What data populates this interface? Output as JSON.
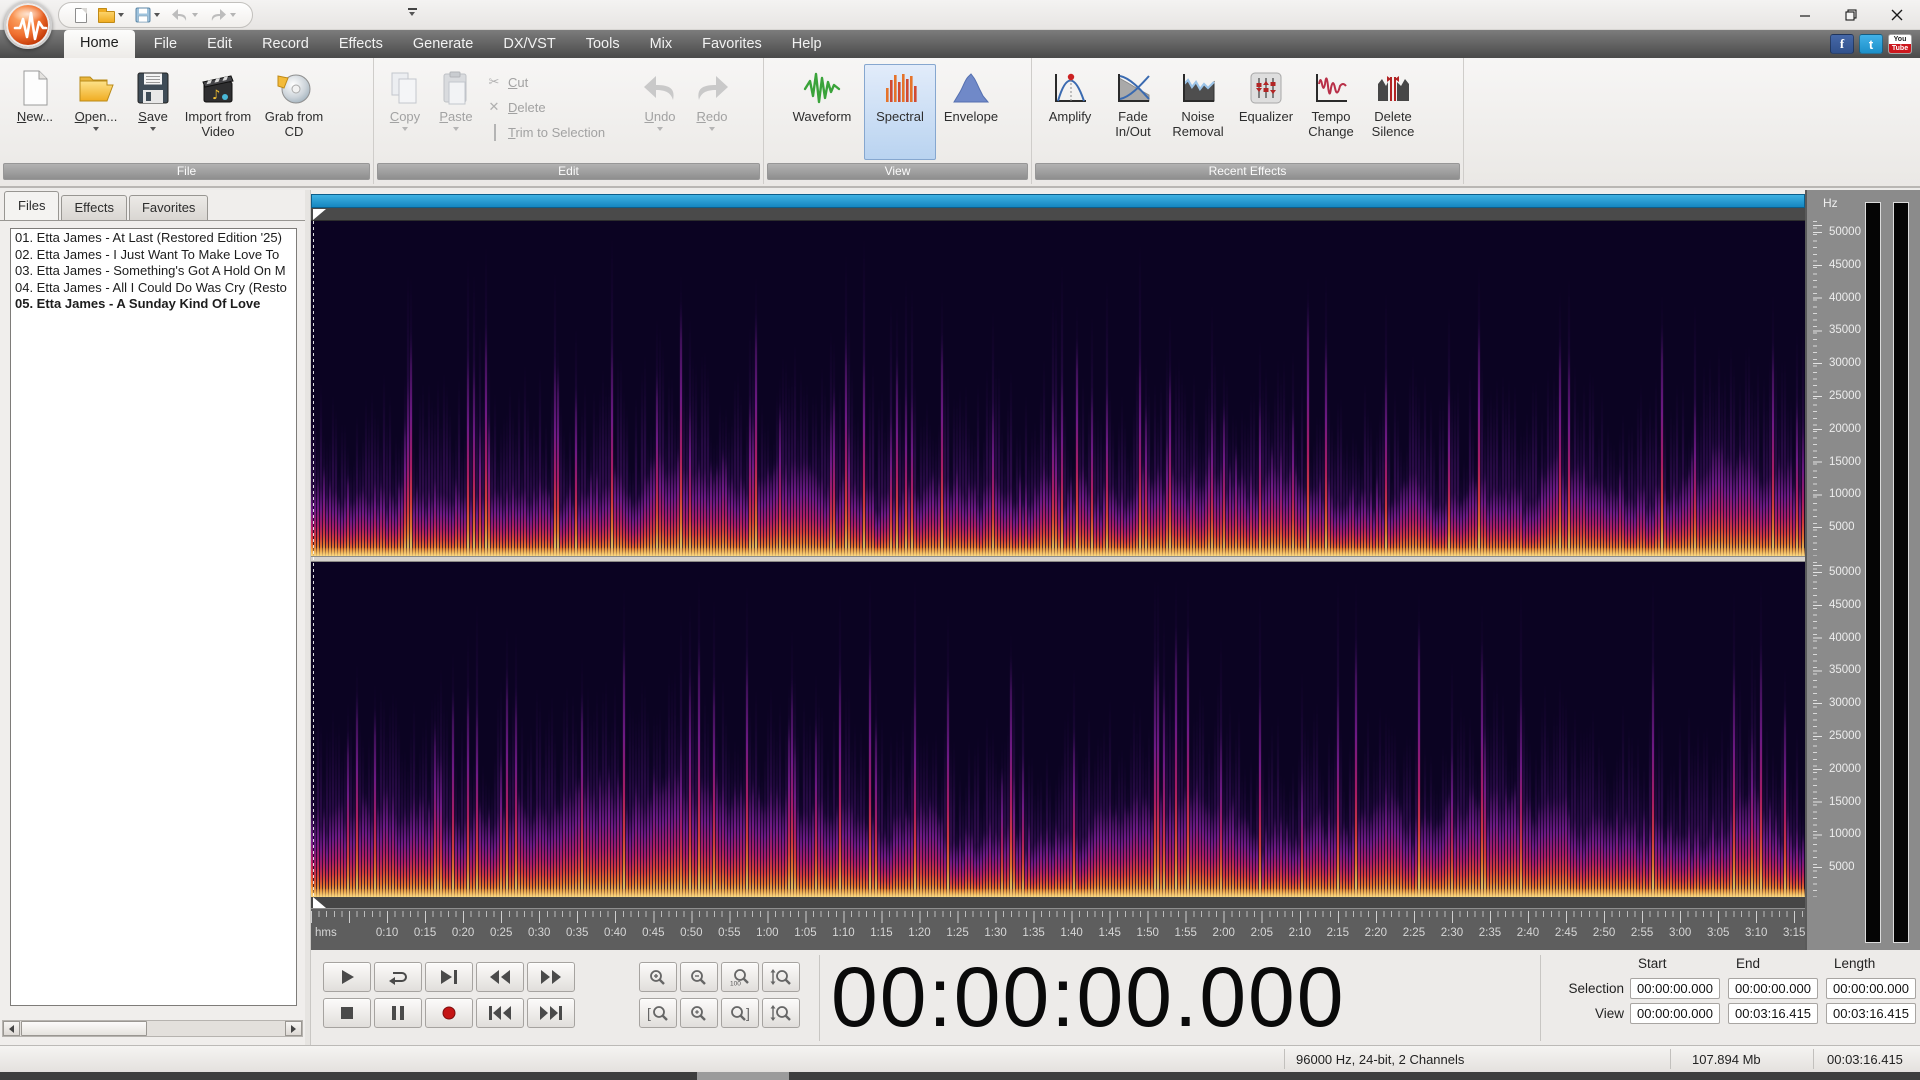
{
  "qat_icons": [
    "new-document",
    "open-folder",
    "save",
    "undo",
    "redo",
    "customize"
  ],
  "ribbon_tabs": [
    {
      "label": "Home",
      "active": true
    },
    {
      "label": "File"
    },
    {
      "label": "Edit"
    },
    {
      "label": "Record"
    },
    {
      "label": "Effects"
    },
    {
      "label": "Generate"
    },
    {
      "label": "DX/VST"
    },
    {
      "label": "Tools"
    },
    {
      "label": "Mix"
    },
    {
      "label": "Favorites"
    },
    {
      "label": "Help"
    }
  ],
  "social_icons": [
    "facebook",
    "twitter",
    "youtube"
  ],
  "ribbon": {
    "groups": {
      "file": "File",
      "edit": "Edit",
      "view": "View",
      "recent": "Recent Effects"
    },
    "new_label": "New...",
    "open_label": "Open...",
    "save_label": "Save",
    "import_label": "Import from Video",
    "grab_label": "Grab from CD",
    "copy_label": "Copy",
    "paste_label": "Paste",
    "cut_label": "Cut",
    "delete_label": "Delete",
    "trim_label": "Trim to Selection",
    "undo_label": "Undo",
    "redo_label": "Redo",
    "waveform_label": "Waveform",
    "spectral_label": "Spectral",
    "envelope_label": "Envelope",
    "amplify_label": "Amplify",
    "fade_label": "Fade In/Out",
    "noise_label": "Noise Removal",
    "equalizer_label": "Equalizer",
    "tempo_label": "Tempo Change",
    "delete_silence_label": "Delete Silence",
    "active_view": "Spectral"
  },
  "left_panel": {
    "tabs": [
      "Files",
      "Effects",
      "Favorites"
    ],
    "active_tab": "Files",
    "files": [
      "01. Etta James - At Last (Restored Edition '25)",
      "02. Etta James - I Just Want To Make Love To",
      "03. Etta James - Something's Got A Hold On M",
      "04. Etta James - All I Could Do Was Cry (Resto",
      "05. Etta James - A Sunday Kind Of Love"
    ],
    "selected_index": 4
  },
  "freq_ruler": {
    "unit": "Hz",
    "labels": [
      "50000",
      "45000",
      "40000",
      "35000",
      "30000",
      "25000",
      "20000",
      "15000",
      "10000",
      "5000"
    ]
  },
  "time_ruler": {
    "origin_label": "hms",
    "labels": [
      "0:10",
      "0:15",
      "0:20",
      "0:25",
      "0:30",
      "0:35",
      "0:40",
      "0:45",
      "0:50",
      "0:55",
      "1:00",
      "1:05",
      "1:10",
      "1:15",
      "1:20",
      "1:25",
      "1:30",
      "1:35",
      "1:40",
      "1:45",
      "1:50",
      "1:55",
      "2:00",
      "2:05",
      "2:10",
      "2:15",
      "2:20",
      "2:25",
      "2:30",
      "2:35",
      "2:40",
      "2:45",
      "2:50",
      "2:55",
      "3:00",
      "3:05",
      "3:10",
      "3:15"
    ]
  },
  "transport": {
    "buttons": [
      "play",
      "loop",
      "play-to-end",
      "rewind",
      "fast-forward",
      "stop",
      "pause",
      "record",
      "go-to-start",
      "go-to-end"
    ]
  },
  "zoom_toolbar": {
    "buttons": [
      "zoom-in",
      "zoom-out",
      "zoom-100",
      "zoom-vertical",
      "zoom-selection-left",
      "zoom-in-alt",
      "zoom-selection-right",
      "zoom-vertical-alt"
    ],
    "zoom_100_text": "100"
  },
  "time_display": "00:00:00.000",
  "position_panel": {
    "col_headers": [
      "Start",
      "End",
      "Length"
    ],
    "rows": [
      {
        "label": "Selection",
        "values": [
          "00:00:00.000",
          "00:00:00.000",
          "00:00:00.000"
        ]
      },
      {
        "label": "View",
        "values": [
          "00:00:00.000",
          "00:03:16.415",
          "00:03:16.415"
        ]
      }
    ]
  },
  "status_bar": {
    "format": "96000 Hz, 24-bit, 2 Channels",
    "file_size": "107.894 Mb",
    "duration": "00:03:16.415"
  },
  "view_length_seconds": 196.415,
  "colors": {
    "position_bar": "#1e96d2",
    "spectrogram_bg": "#0b0322",
    "active_view_button": "#b9d3f0"
  }
}
